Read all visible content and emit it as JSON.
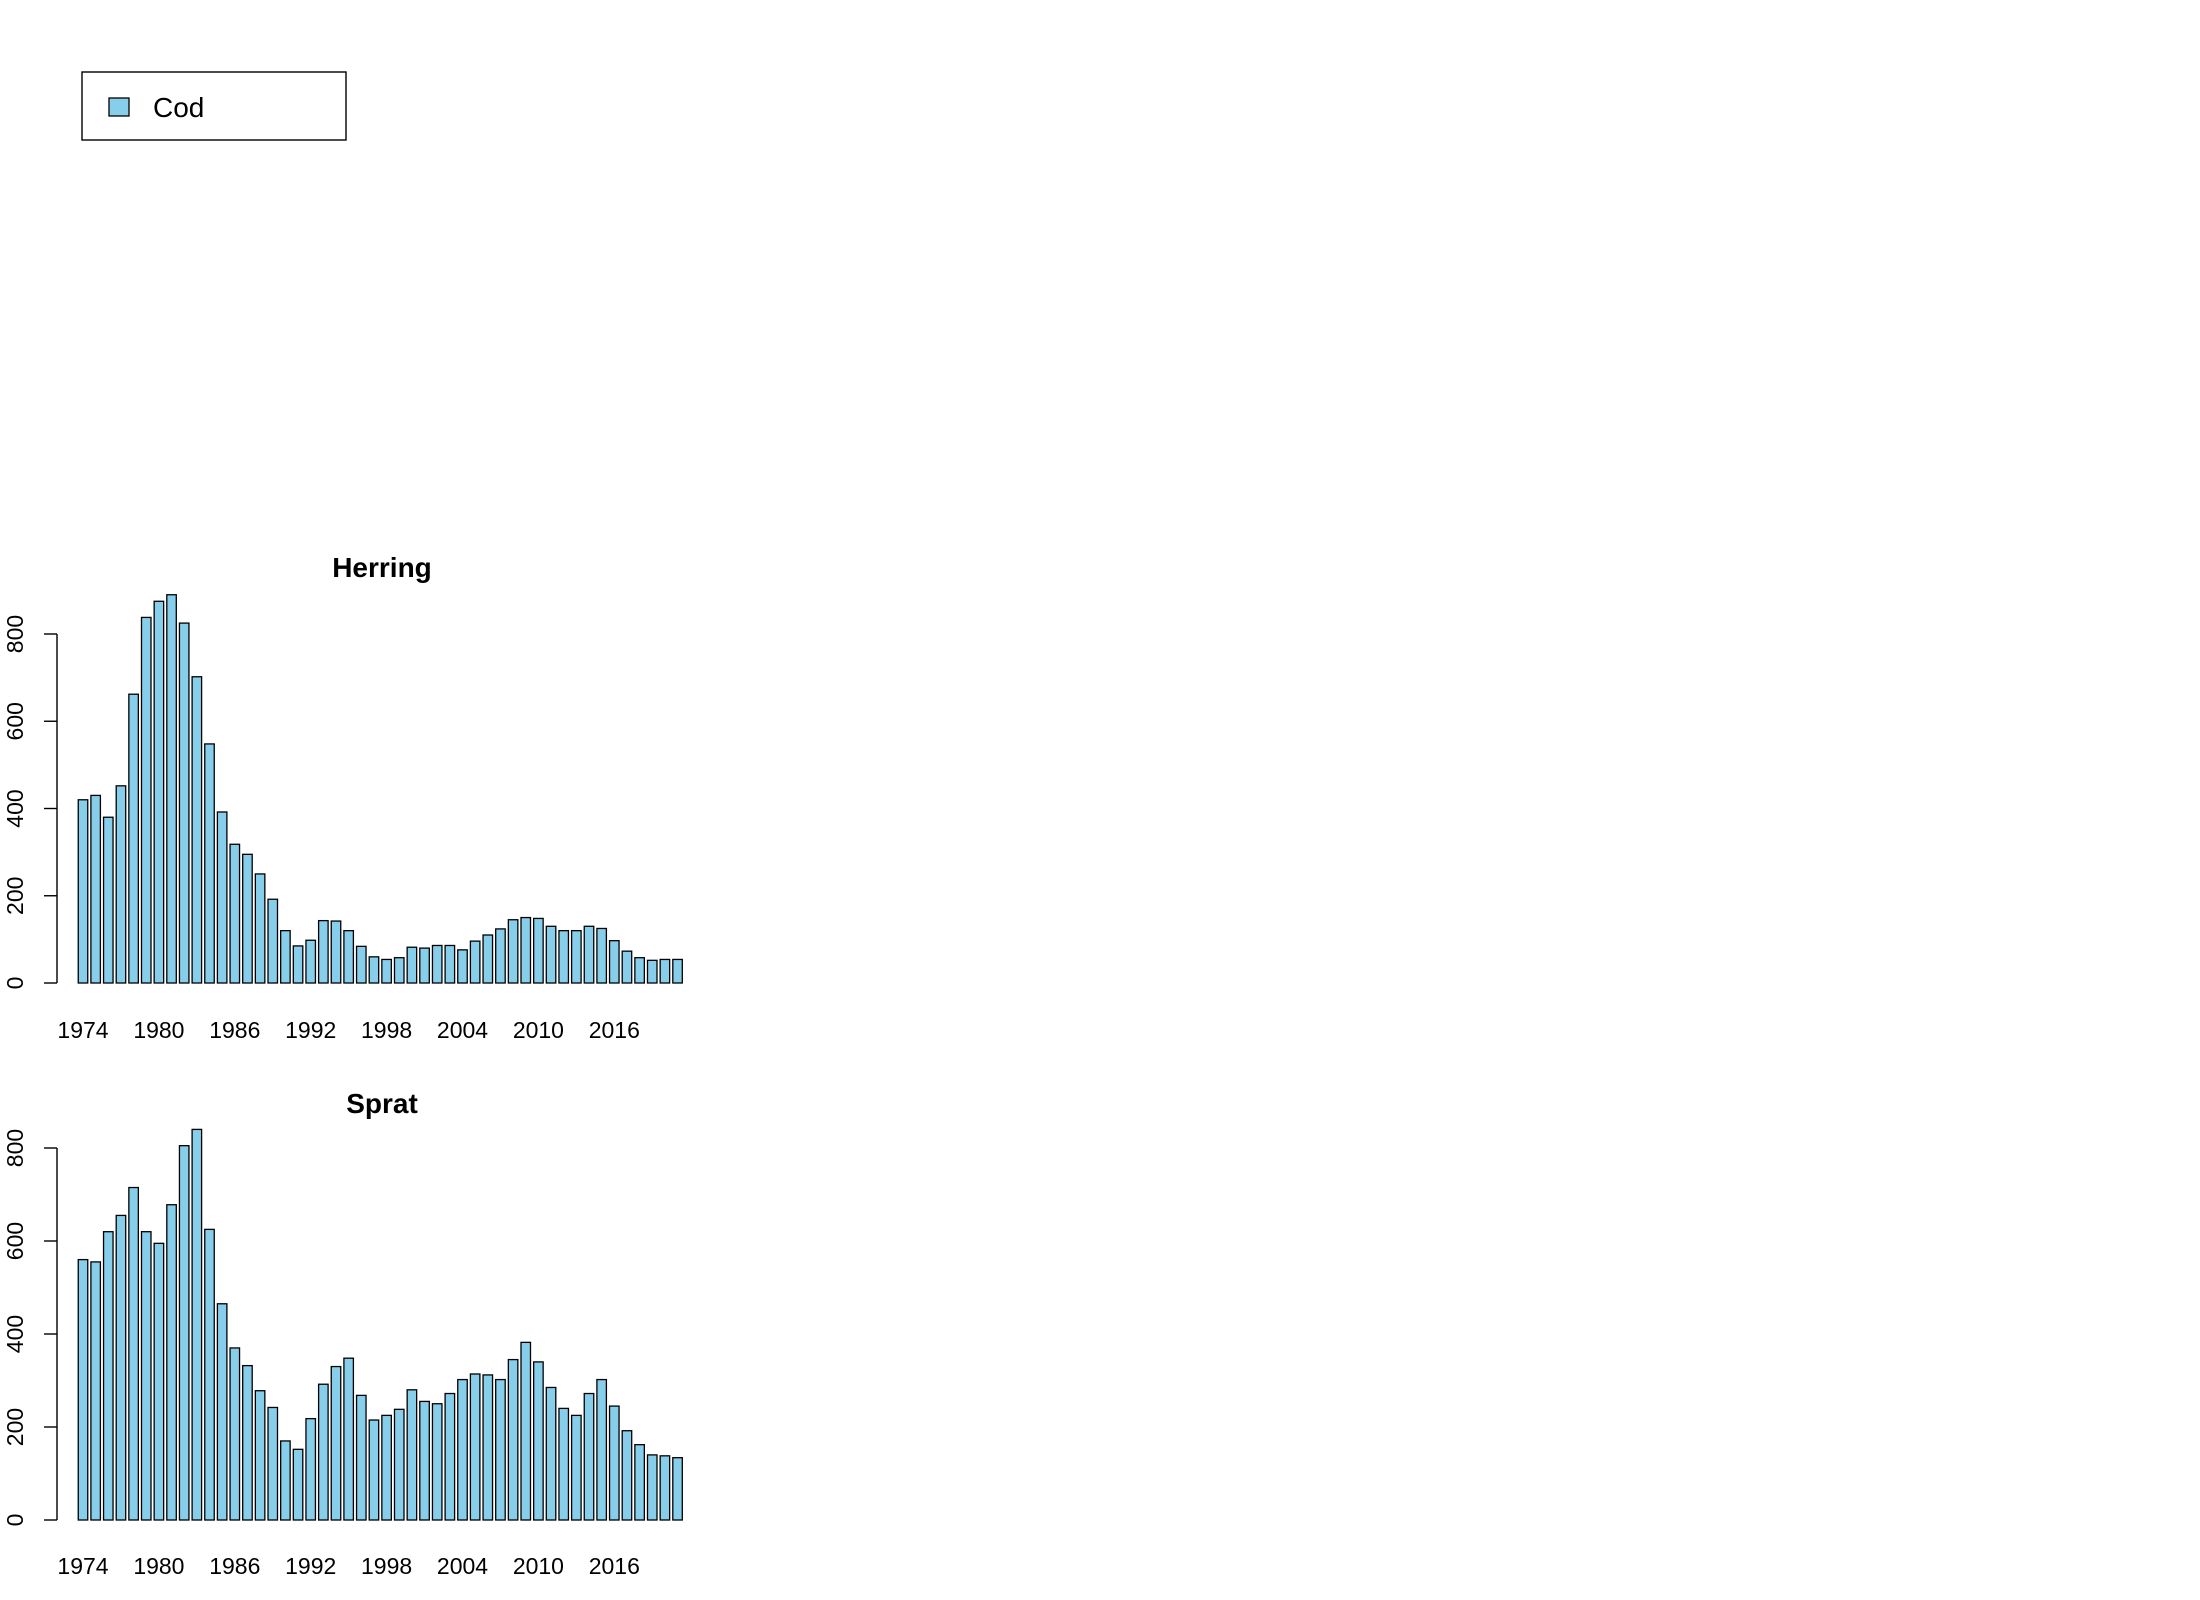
{
  "legend": {
    "label": "Cod",
    "color": "#87ceeb"
  },
  "chart_data": [
    {
      "type": "bar",
      "title": "Herring",
      "xlabel": "",
      "ylabel": "",
      "ylim": [
        0,
        900
      ],
      "y_ticks": [
        0,
        200,
        400,
        600,
        800
      ],
      "x_tick_labels": [
        "1974",
        "1980",
        "1986",
        "1992",
        "1998",
        "2004",
        "2010",
        "2016"
      ],
      "categories": [
        1974,
        1975,
        1976,
        1977,
        1978,
        1979,
        1980,
        1981,
        1982,
        1983,
        1984,
        1985,
        1986,
        1987,
        1988,
        1989,
        1990,
        1991,
        1992,
        1993,
        1994,
        1995,
        1996,
        1997,
        1998,
        1999,
        2000,
        2001,
        2002,
        2003,
        2004,
        2005,
        2006,
        2007,
        2008,
        2009,
        2010,
        2011,
        2012,
        2013,
        2014,
        2015,
        2016,
        2017,
        2018,
        2019,
        2020,
        2021
      ],
      "series": [
        {
          "name": "Cod",
          "values": [
            420,
            430,
            380,
            452,
            662,
            838,
            875,
            890,
            825,
            702,
            548,
            392,
            318,
            295,
            250,
            192,
            120,
            85,
            98,
            143,
            142,
            120,
            84,
            60,
            54,
            58,
            82,
            80,
            86,
            86,
            76,
            96,
            110,
            124,
            145,
            150,
            148,
            130,
            120,
            120,
            130,
            125,
            97,
            73,
            58,
            52,
            54,
            54
          ]
        }
      ]
    },
    {
      "type": "bar",
      "title": "Sprat",
      "xlabel": "",
      "ylabel": "",
      "ylim": [
        0,
        850
      ],
      "y_ticks": [
        0,
        200,
        400,
        600,
        800
      ],
      "x_tick_labels": [
        "1974",
        "1980",
        "1986",
        "1992",
        "1998",
        "2004",
        "2010",
        "2016"
      ],
      "categories": [
        1974,
        1975,
        1976,
        1977,
        1978,
        1979,
        1980,
        1981,
        1982,
        1983,
        1984,
        1985,
        1986,
        1987,
        1988,
        1989,
        1990,
        1991,
        1992,
        1993,
        1994,
        1995,
        1996,
        1997,
        1998,
        1999,
        2000,
        2001,
        2002,
        2003,
        2004,
        2005,
        2006,
        2007,
        2008,
        2009,
        2010,
        2011,
        2012,
        2013,
        2014,
        2015,
        2016,
        2017,
        2018,
        2019,
        2020,
        2021
      ],
      "series": [
        {
          "name": "Cod",
          "values": [
            560,
            555,
            620,
            655,
            715,
            620,
            595,
            678,
            805,
            840,
            625,
            465,
            370,
            332,
            278,
            242,
            170,
            152,
            218,
            292,
            330,
            348,
            268,
            215,
            225,
            238,
            280,
            255,
            250,
            272,
            302,
            314,
            312,
            302,
            345,
            382,
            340,
            285,
            240,
            225,
            272,
            302,
            245,
            192,
            162,
            140,
            138,
            134
          ]
        }
      ]
    }
  ]
}
